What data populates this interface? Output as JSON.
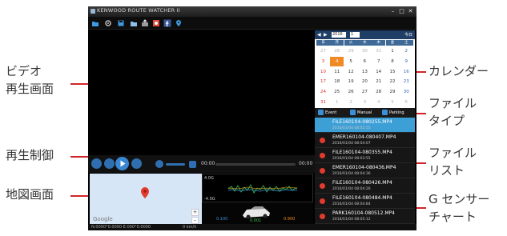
{
  "callouts": {
    "video_line1": "ビデオ",
    "video_line2": "再生画面",
    "playback": "再生制御",
    "map": "地図画面",
    "calendar": "カレンダー",
    "filetype_line1": "ファイル",
    "filetype_line2": "タイプ",
    "filelist_line1": "ファイル",
    "filelist_line2": "リスト",
    "gsensor_line1": "G センサー",
    "gsensor_line2": "チャート"
  },
  "colors": {
    "accent": "#3c9fd6",
    "leader": "#d2232a",
    "selected_day": "#f08a24"
  },
  "window": {
    "title": "KENWOOD ROUTE WATCHER II",
    "minimize": "–",
    "maximize": "□",
    "close": "✕"
  },
  "toolbar": {
    "icons": [
      "folder-icon",
      "settings-icon",
      "save-icon",
      "folder-open-icon",
      "export-icon",
      "photo-icon",
      "facebook-icon",
      "location-icon"
    ]
  },
  "player": {
    "time_start": "00:00",
    "time_end": "00:00"
  },
  "calendar": {
    "year": "2016",
    "month": "1",
    "today_label": "今日",
    "weekdays": [
      "日",
      "月",
      "火",
      "水",
      "木",
      "金",
      "土"
    ],
    "weeks": [
      [
        "27",
        "28",
        "29",
        "30",
        "31",
        "1",
        "2"
      ],
      [
        "3",
        "4",
        "5",
        "6",
        "7",
        "8",
        "9"
      ],
      [
        "10",
        "11",
        "12",
        "13",
        "14",
        "15",
        "16"
      ],
      [
        "17",
        "18",
        "19",
        "20",
        "21",
        "22",
        "23"
      ],
      [
        "24",
        "25",
        "26",
        "27",
        "28",
        "29",
        "30"
      ],
      [
        "31",
        "1",
        "2",
        "3",
        "4",
        "5",
        "6"
      ]
    ],
    "selected_day": "4"
  },
  "file_types": [
    "Event",
    "Manual",
    "Parking"
  ],
  "files": [
    {
      "name": "FILE160104-080255.MP4",
      "date": "2016/01/04 08:02:55"
    },
    {
      "name": "EMER160104-080407.MP4",
      "date": "2016/01/04 08:04:07"
    },
    {
      "name": "FILE160104-080355.MP4",
      "date": "2016/01/04 08:03:55"
    },
    {
      "name": "EMER160104-080436.MP4",
      "date": "2016/01/04 08:04:36"
    },
    {
      "name": "FILE160104-080426.MP4",
      "date": "2016/01/04 08:04:26"
    },
    {
      "name": "FILE160104-080484.MP4",
      "date": "2016/01/04 08:04:84"
    },
    {
      "name": "PARK160104-080512.MP4",
      "date": "2016/01/04 08:05:12"
    }
  ],
  "gsensor": {
    "top_label": "4.0G",
    "bottom_label": "-4.0G",
    "readouts": [
      "0.100",
      "0.001",
      "0.900"
    ]
  },
  "map": {
    "logo": "Google"
  },
  "status": {
    "coords": "N:0000°0.0000 E:000°0.0000",
    "speed": "0 km/h"
  }
}
